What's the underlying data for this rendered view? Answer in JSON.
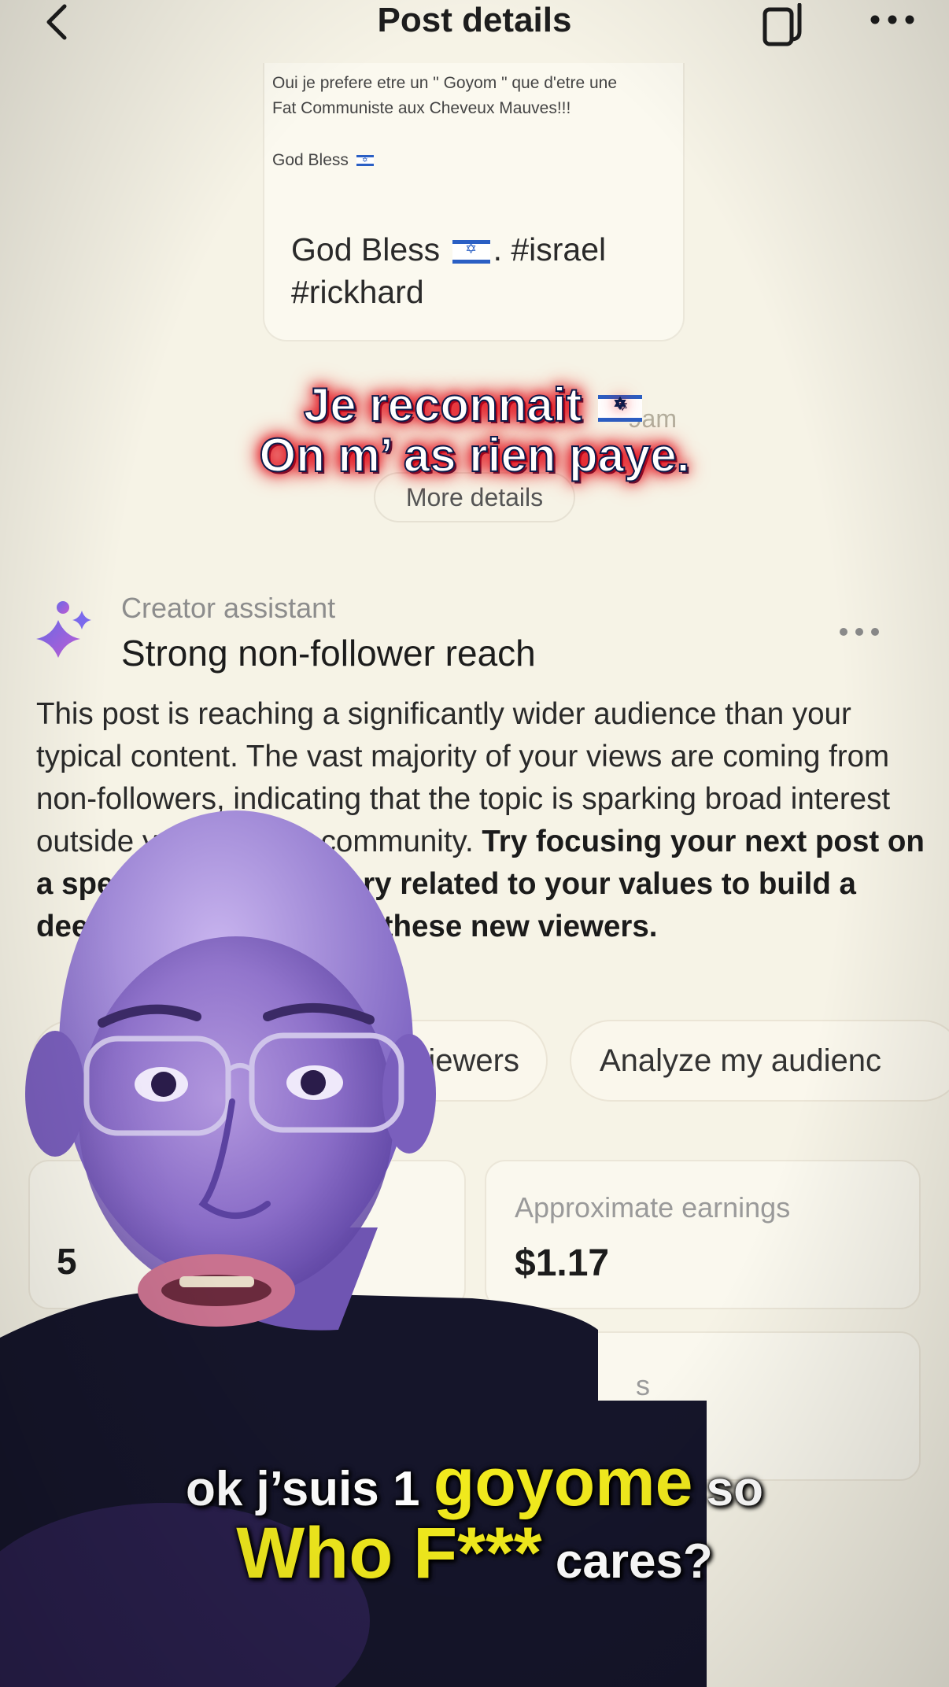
{
  "header": {
    "title": "Post details"
  },
  "post_preview": {
    "thumb_line1": "Oui je prefere etre un \" Goyom \" que d'etre une",
    "thumb_line2": "Fat Communiste aux Cheveux Mauves!!!",
    "thumb_line3": "God Bless",
    "caption_part1": "God Bless",
    "caption_part2": ". #israel",
    "caption_line2": "#rickhard",
    "faded_time": "9am",
    "more_details": "More details"
  },
  "overlay_top": {
    "line1": "Je reconnait",
    "line2": "On m’  as rien paye."
  },
  "creator_assistant": {
    "label": "Creator assistant",
    "title": "Strong non-follower reach",
    "body_regular": "This post is reaching a significantly wider audience than your typical content. The vast majority of your views are coming from non-followers, indicating that the topic is sparking broad interest outside your existing community. ",
    "body_bold": "Try focusing your next post on a specific personal story related to your values to build a deeper connection with these new viewers."
  },
  "chips": [
    {
      "label": "iewers"
    },
    {
      "label": "Analyze my audienc"
    }
  ],
  "stats": {
    "partial_value": "5",
    "earnings_label": "Approximate earnings",
    "earnings_value": "$1.17",
    "third_label": "s"
  },
  "overlay_bottom": {
    "line1_pre": "ok j’suis 1 ",
    "line1_highlight": "goyome",
    "line1_post": " so",
    "line2_highlight": "Who F***",
    "line2_post": " cares?"
  },
  "colors": {
    "background": "#f6f3e6",
    "caption_yellow": "#f1ea1d",
    "caption_red_glow": "#e2000f",
    "assistant_gradient": [
      "#6c6cf0",
      "#c45ed6"
    ]
  }
}
